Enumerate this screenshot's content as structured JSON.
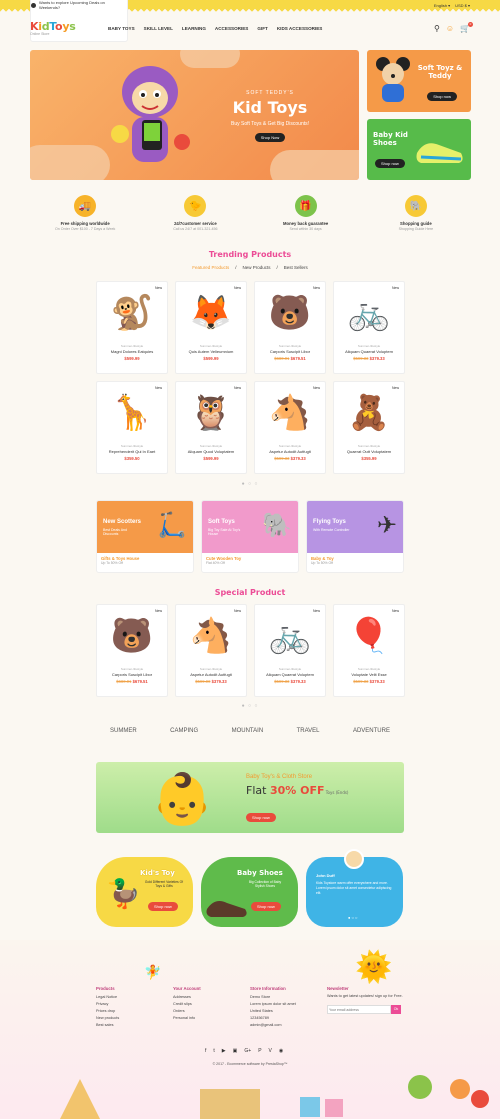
{
  "topbar": {
    "promo": "Wants to explore Upcoming Deals on Weekends?",
    "lang": "English ▾",
    "currency": "USD $ ▾"
  },
  "logo": {
    "letters": [
      "K",
      "i",
      "d",
      "T",
      "o",
      "y",
      "s"
    ],
    "sub": "Online Store"
  },
  "nav": [
    "BABY TOYS",
    "SKILL LEVEL",
    "LEARNING",
    "ACCESSORIES",
    "GIFT",
    "KIDS ACCESSORIES"
  ],
  "cart_count": "0",
  "hero": {
    "small": "SOFT TEDDY'S",
    "big": "Kid Toys",
    "desc": "Buy Soft Toys & Get Big Discounts!",
    "btn": "Shop Now"
  },
  "side": [
    {
      "title": "Soft Toyz & Teddy",
      "btn": "Shop now",
      "color": "#f59a48"
    },
    {
      "title": "Baby Kid Shoes",
      "btn": "Shop now",
      "color": "#57bb4a"
    }
  ],
  "services": [
    {
      "h": "Free shipping worldwide",
      "s": "On Order Over $100 - 7 Days a Week",
      "color": "#f7b329",
      "icon": "truck-icon",
      "glyph": "🚚"
    },
    {
      "h": "24/7customer service",
      "s": "Call us 24/7 at 001-321-456",
      "color": "#f7c935",
      "icon": "duck-icon",
      "glyph": "🐤"
    },
    {
      "h": "Money back guarantee",
      "s": "Send within 30 days",
      "color": "#7dc34b",
      "icon": "gift-icon",
      "glyph": "🎁"
    },
    {
      "h": "Shopping guide",
      "s": "Shopping Guide Here",
      "color": "#f7c935",
      "icon": "elephant-icon",
      "glyph": "🐘"
    }
  ],
  "trending": {
    "title": "Trending Products",
    "tabs": [
      "Featured Products",
      "New Products",
      "Best Sellers"
    ]
  },
  "products": [
    {
      "badge": "New",
      "cat": "Summer-lifestyle",
      "name": "Magni Dolores Eatquies",
      "price": "$599.99",
      "old": "",
      "glyph": "🐒"
    },
    {
      "badge": "New",
      "cat": "Summer-lifestyle",
      "name": "Quis Autem Velieumnium",
      "price": "$599.99",
      "old": "",
      "glyph": "🦊"
    },
    {
      "badge": "New",
      "cat": "Summer-lifestyle",
      "name": "Carporis Suscipit Libor",
      "price": "$679.51",
      "old": "$680.01",
      "glyph": "🐻"
    },
    {
      "badge": "New",
      "cat": "Summer-lifestyle",
      "name": "Aliquam Quaerat Voluptem",
      "price": "$379.33",
      "old": "$599.33",
      "glyph": "🚲"
    },
    {
      "badge": "New",
      "cat": "Summer-lifestyle",
      "name": "Reprehenderit Qui In Eaet",
      "price": "$359.50",
      "old": "",
      "glyph": "🦒"
    },
    {
      "badge": "New",
      "cat": "Summer-lifestyle",
      "name": "Aliquam Quod Voluptatem",
      "price": "$599.99",
      "old": "",
      "glyph": "🦉"
    },
    {
      "badge": "New",
      "cat": "Summer-lifestyle",
      "name": "Aspetur Autodit Autfugit",
      "price": "$379.33",
      "old": "$599.33",
      "glyph": "🐴"
    },
    {
      "badge": "New",
      "cat": "Summer-lifestyle",
      "name": "Quaerat Outt Voluptatem",
      "price": "$355.99",
      "old": "",
      "glyph": "🧸"
    }
  ],
  "promos": [
    {
      "title": "New Scotters",
      "desc": "Best Deals And Discounts",
      "name": "Gifts & Toys House",
      "sub": "Up To 50% Off",
      "color": "#f59a48"
    },
    {
      "title": "Soft Toys",
      "desc": "Big Toy Sale At Toy's House",
      "name": "Cute Wooden Toy",
      "sub": "Flat 40% Off",
      "color": "#f19acb"
    },
    {
      "title": "Flying Toys",
      "desc": "With Remote Controller",
      "name": "Baby & Toy",
      "sub": "Up To 50% Off",
      "color": "#b794e3"
    }
  ],
  "special": {
    "title": "Special Product"
  },
  "specials": [
    {
      "badge": "New",
      "cat": "Summer-lifestyle",
      "name": "Carporis Suscipit Libor",
      "price": "$679.51",
      "old": "$680.01",
      "glyph": "🐻"
    },
    {
      "badge": "New",
      "cat": "Summer-lifestyle",
      "name": "Aspetur Autodit Autfugit",
      "price": "$379.33",
      "old": "$599.00",
      "glyph": "🐴"
    },
    {
      "badge": "New",
      "cat": "Summer-lifestyle",
      "name": "Aliquam Quaerat Voluptem",
      "price": "$379.33",
      "old": "$599.33",
      "glyph": "🚲"
    },
    {
      "badge": "New",
      "cat": "Summer-lifestyle",
      "name": "Voluptate Velit Esse",
      "price": "$379.33",
      "old": "$599.33",
      "glyph": "🎈"
    }
  ],
  "brands": [
    "SUMMER",
    "CAMPING",
    "MOUNTAIN",
    "TRAVEL",
    "ADVENTURE"
  ],
  "banner": {
    "a": "Baby Toy's & Cloth Store",
    "b1": "Flat ",
    "b2": "30% OFF",
    "b3": " Toys (Ends)",
    "btn": "Shop now"
  },
  "blobs": [
    {
      "title": "Kid's Toy",
      "desc": "Gold Different Varieties Of Toys & Gifts",
      "btn": "Shop now"
    },
    {
      "title": "Baby Shoes",
      "desc": "Big Collection of Baby Stylish Shoes",
      "btn": "Shop now"
    },
    {
      "name": "John Duff",
      "text": "Kids Toystore warm offer everywhere and more. Lorem ipsum dolor sit amet consectetur adipiscing elit."
    }
  ],
  "footer": {
    "products": {
      "h": "Products",
      "items": [
        "Legal Notice",
        "Privacy",
        "Prices drop",
        "New products",
        "Best sales"
      ]
    },
    "account": {
      "h": "Your Account",
      "items": [
        "Addresses",
        "Credit slips",
        "Orders",
        "Personal info"
      ]
    },
    "store": {
      "h": "Store Information",
      "items": [
        "Demo Store",
        "Lorem ipsum dolor sit amet",
        "United States",
        "123456789",
        "admin@gmail.com"
      ]
    },
    "newsletter": {
      "h": "Newsletter",
      "desc": "Wants to get latest updates! sign up for Free.",
      "placeholder": "Your email address",
      "btn": "Ok"
    },
    "social": [
      "f",
      "t",
      "▶",
      "▣",
      "G+",
      "P",
      "V",
      "◉"
    ],
    "copy": "© 2017 - Ecommerce software by PrestaShop™"
  }
}
